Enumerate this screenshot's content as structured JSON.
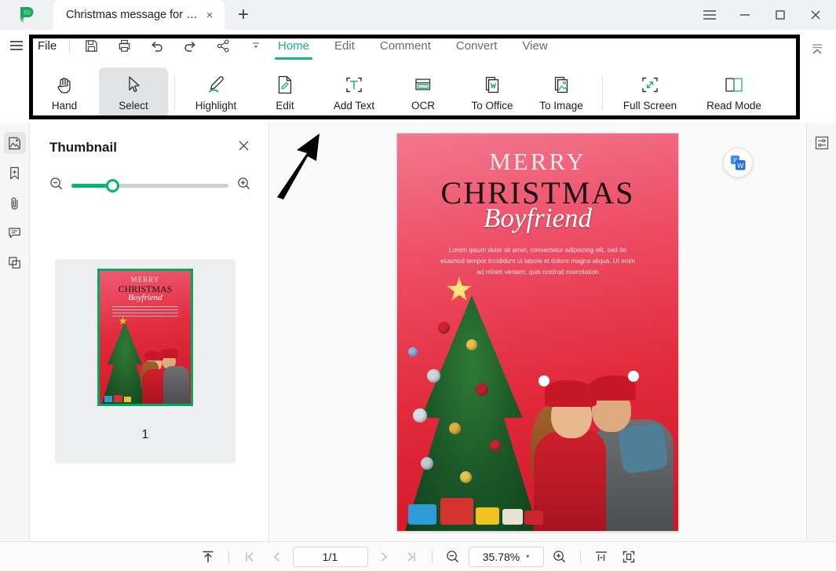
{
  "window": {
    "app_logo": "pdfelement-logo",
    "tab_title": "Christmas message for b...",
    "tab_close": "×",
    "new_tab": "+",
    "menu_icon": "hamburger-menu-icon",
    "minimize": "—",
    "maximize": "□",
    "close": "✕"
  },
  "quick_access": {
    "app_menu": "hamburger-menu-icon",
    "file_label": "File",
    "items": [
      {
        "name": "save-icon",
        "label": "Save"
      },
      {
        "name": "print-icon",
        "label": "Print"
      },
      {
        "name": "undo-icon",
        "label": "Undo"
      },
      {
        "name": "redo-icon",
        "label": "Redo"
      },
      {
        "name": "share-icon",
        "label": "Share"
      },
      {
        "name": "more-dropdown-icon",
        "label": "More"
      }
    ]
  },
  "ribbon": {
    "tabs": [
      {
        "label": "Home",
        "active": true
      },
      {
        "label": "Edit",
        "active": false
      },
      {
        "label": "Comment",
        "active": false
      },
      {
        "label": "Convert",
        "active": false
      },
      {
        "label": "View",
        "active": false
      }
    ],
    "collapse_icon": "collapse-ribbon-icon",
    "tools": [
      {
        "label": "Hand",
        "icon": "hand-icon",
        "selected": false
      },
      {
        "label": "Select",
        "icon": "cursor-arrow-icon",
        "selected": true
      },
      {
        "label": "Highlight",
        "icon": "highlighter-pen-icon",
        "selected": false
      },
      {
        "label": "Edit",
        "icon": "edit-document-icon",
        "selected": false
      },
      {
        "label": "Add Text",
        "icon": "add-text-icon",
        "selected": false
      },
      {
        "label": "OCR",
        "icon": "ocr-icon",
        "selected": false
      },
      {
        "label": "To Office",
        "icon": "to-word-icon",
        "selected": false
      },
      {
        "label": "To Image",
        "icon": "to-image-icon",
        "selected": false
      },
      {
        "label": "Full Screen",
        "icon": "full-screen-icon",
        "selected": false
      },
      {
        "label": "Read Mode",
        "icon": "book-open-icon",
        "selected": false
      }
    ]
  },
  "annotations": {
    "highlight_rect": "black-rectangle-outline",
    "arrow": "black-arrow-pointing-up-right"
  },
  "left_rail": [
    {
      "name": "thumbnail-panel-icon",
      "label": "Thumbnail",
      "active": true
    },
    {
      "name": "bookmark-add-icon",
      "label": "Bookmark",
      "active": false
    },
    {
      "name": "attachment-paperclip-icon",
      "label": "Attachment",
      "active": false
    },
    {
      "name": "comment-bubble-icon",
      "label": "Comment",
      "active": false
    },
    {
      "name": "layers-icon",
      "label": "Layers",
      "active": false
    }
  ],
  "right_rail": [
    {
      "name": "properties-sliders-icon",
      "label": "Properties"
    }
  ],
  "thumbnail_panel": {
    "title": "Thumbnail",
    "close_icon": "close-icon",
    "zoom_out_icon": "zoom-out-icon",
    "zoom_in_icon": "zoom-in-icon",
    "slider_value": "22",
    "pages": [
      {
        "number": "1",
        "selected": true
      }
    ]
  },
  "viewer": {
    "float_button_icon": "convert-to-word-icon",
    "page": {
      "title_line1": "MERRY",
      "title_line2": "CHRISTMAS",
      "script_word": "Boyfriend",
      "body_text": "Lorem ipsum dolor sit amet, consectetur adipiscing elit, sed do eiusmod tempor incididunt ut labore et dolore magna aliqua. Ut enim ad minim veniam, quis nostrud exercitation",
      "artwork": "christmas-tree-and-couple-illustration"
    }
  },
  "statusbar": {
    "fit_top_icon": "scroll-to-top-icon",
    "first_page_icon": "first-page-icon",
    "prev_page_icon": "previous-page-icon",
    "page_indicator": "1/1",
    "next_page_icon": "next-page-icon",
    "last_page_icon": "last-page-icon",
    "zoom_out_icon": "zoom-out-icon",
    "zoom_value": "35.78%",
    "zoom_caret": "▾",
    "zoom_in_icon": "zoom-in-icon",
    "fit_width_icon": "fit-width-icon",
    "fit_page_icon": "fit-page-icon"
  },
  "colors": {
    "accent_green": "#14b87a",
    "slider_green": "#00b96b",
    "thumb_border_green": "#00a862",
    "annotation_black": "#000000",
    "poster_red": "#d81f2a"
  }
}
